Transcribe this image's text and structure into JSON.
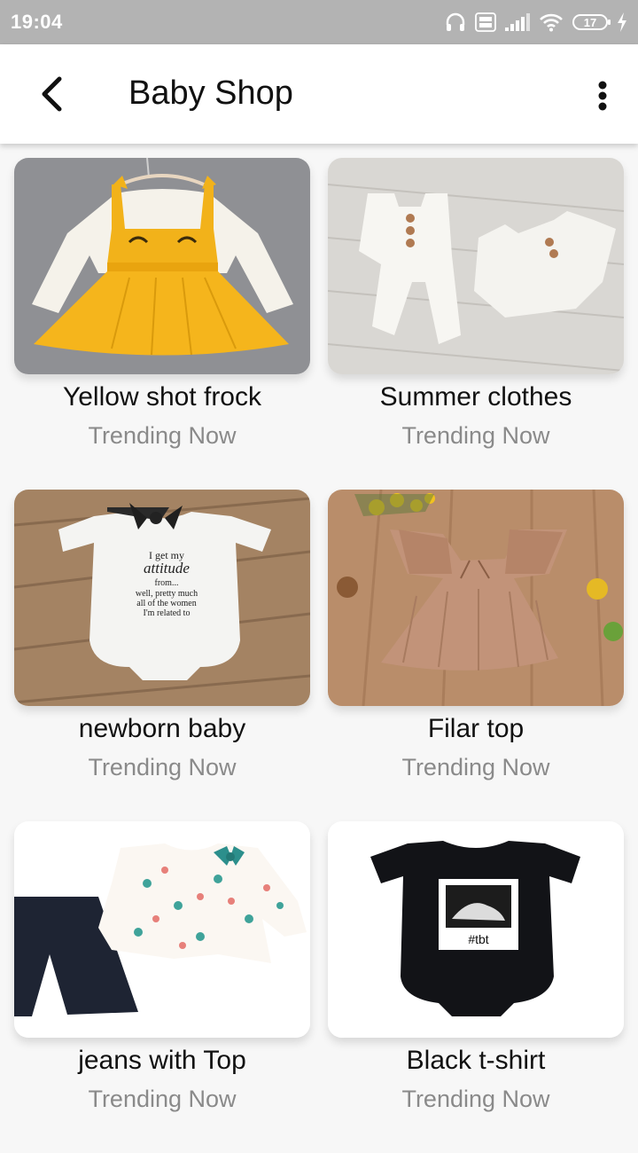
{
  "status_bar": {
    "time": "19:04",
    "battery": "17",
    "icons": [
      "headphones-icon",
      "volte-icon",
      "signal-icon",
      "wifi-icon",
      "battery-icon",
      "charging-icon"
    ]
  },
  "app_bar": {
    "title": "Baby Shop",
    "back_icon": "back-arrow-icon",
    "menu_icon": "more-vert-icon"
  },
  "products": [
    {
      "title": "Yellow shot frock",
      "subtitle": "Trending Now"
    },
    {
      "title": "Summer clothes",
      "subtitle": "Trending Now"
    },
    {
      "title": "newborn baby",
      "subtitle": "Trending Now"
    },
    {
      "title": "Filar top",
      "subtitle": "Trending Now"
    },
    {
      "title": "jeans with Top",
      "subtitle": "Trending Now"
    },
    {
      "title": "Black t-shirt",
      "subtitle": "Trending Now"
    }
  ],
  "onesie_print": {
    "line1": "I get my",
    "line2": "attitude",
    "line3": "from...",
    "line4": "well, pretty much",
    "line5": "all of the women",
    "line6": "I'm related to"
  },
  "tshirt_print": "#tbt"
}
